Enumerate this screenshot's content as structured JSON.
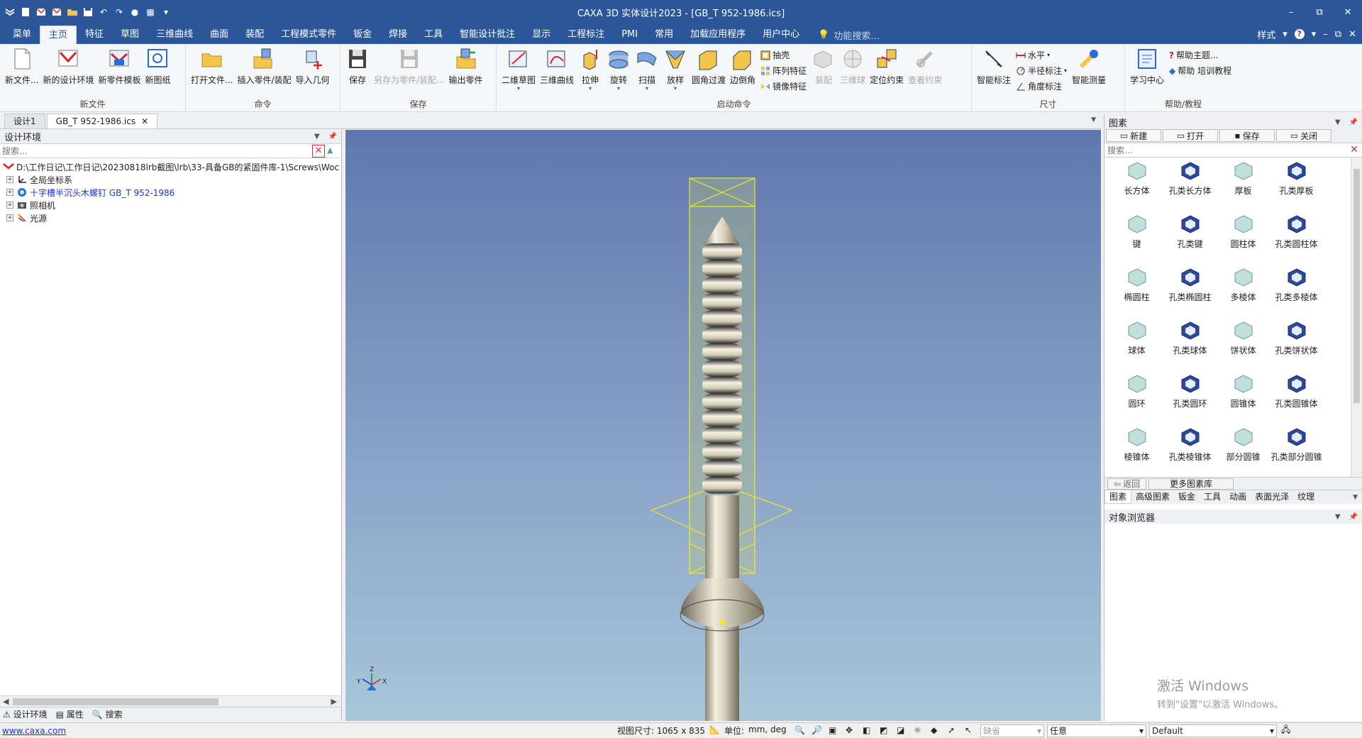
{
  "window": {
    "title": "CAXA 3D 实体设计2023 - [GB_T 952-1986.ics]",
    "controls": [
      "–",
      "⧉",
      "✕"
    ]
  },
  "menu": {
    "tabs": [
      "菜单",
      "主页",
      "特征",
      "草图",
      "三维曲线",
      "曲面",
      "装配",
      "工程模式零件",
      "钣金",
      "焊接",
      "工具",
      "智能设计批注",
      "显示",
      "工程标注",
      "PMI",
      "常用",
      "加载应用程序",
      "用户中心"
    ],
    "active": "主页",
    "search_placeholder": "功能搜索...",
    "style_label": "样式",
    "right_controls": [
      "–",
      "⧉",
      "✕"
    ]
  },
  "ribbon": {
    "groups": {
      "new_file": "新文件",
      "command": "命令",
      "save": "保存",
      "launch": "启动命令",
      "dimension": "尺寸",
      "help": "帮助/教程"
    },
    "buttons": {
      "new_file": "新文件...",
      "new_design_env": "新的设计环境",
      "new_part_template": "新零件模板",
      "new_drawing": "新图纸",
      "open_file": "打开文件...",
      "insert_part": "插入零件/装配",
      "import_geometry": "导入几何",
      "save": "保存",
      "save_as": "另存为零件/装配...",
      "export_part": "输出零件",
      "sketch_2d": "二维草图",
      "curve_3d": "三维曲线",
      "extrude": "拉伸",
      "revolve": "旋转",
      "sweep": "扫描",
      "loft": "放样",
      "fillet": "圆角过渡",
      "chamfer": "边倒角",
      "shell": "抽壳",
      "pattern": "阵列特征",
      "mirror": "镜像特征",
      "assemble": "装配",
      "ball_3d": "三维球",
      "position_constraint": "定位约束",
      "view_constraint": "查看约束",
      "smart_dimension": "智能标注",
      "horizontal": "水平",
      "radius_dim": "半径标注",
      "angle_dim": "角度标注",
      "smart_measure": "智能测量",
      "learning_center": "学习中心",
      "help_topics": "帮助主题...",
      "help_training": "帮助 培训教程"
    }
  },
  "doctabs": [
    "设计1",
    "GB_T 952-1986.ics"
  ],
  "left_panel": {
    "title": "设计环境",
    "search_placeholder": "搜索...",
    "tree": [
      {
        "label": "D:\\工作日记\\工作日记\\20230818lrb截图\\lrb\\33-具备GB的紧固件库-1\\Screws\\Woc"
      },
      {
        "label": "全局坐标系"
      },
      {
        "label": "十字槽半沉头木螺钉 GB_T 952-1986"
      },
      {
        "label": "照相机"
      },
      {
        "label": "光源"
      }
    ],
    "tabs": [
      "设计环境",
      "属性",
      "搜索"
    ]
  },
  "viewport": {
    "axis_labels": {
      "z": "Z",
      "y": "Y",
      "x": "X"
    }
  },
  "library": {
    "title": "图素",
    "buttons": [
      "新建",
      "打开",
      "保存",
      "关闭"
    ],
    "search_placeholder": "搜索...",
    "items": [
      "长方体",
      "孔类长方体",
      "厚板",
      "孔类厚板",
      "键",
      "孔类键",
      "圆柱体",
      "孔类圆柱体",
      "椭圆柱",
      "孔类椭圆柱",
      "多棱体",
      "孔类多棱体",
      "球体",
      "孔类球体",
      "饼状体",
      "孔类饼状体",
      "圆环",
      "孔类圆环",
      "圆锥体",
      "孔类圆锥体",
      "棱锥体",
      "孔类棱锥体",
      "部分圆锥",
      "孔类部分圆锥"
    ],
    "back_label": "返回",
    "more_label": "更多图素库",
    "tabs": [
      "图素",
      "高级图素",
      "钣金",
      "工具",
      "动画",
      "表面光泽",
      "纹理"
    ]
  },
  "object_browser": {
    "title": "对象浏览器"
  },
  "watermark": {
    "line1": "激活 Windows",
    "line2": "转到\"设置\"以激活 Windows。"
  },
  "status": {
    "url": "www.caxa.com",
    "view_size": "视图尺寸: 1065 x  835",
    "unit_label": "单位:",
    "unit_value": "mm, deg",
    "default_field": "缺省",
    "filter_value": "任意",
    "style_value": "Default"
  },
  "colors": {
    "brand": "#2b579a",
    "tree_link": "#1a33d6",
    "bbox": "#e8e82a"
  }
}
